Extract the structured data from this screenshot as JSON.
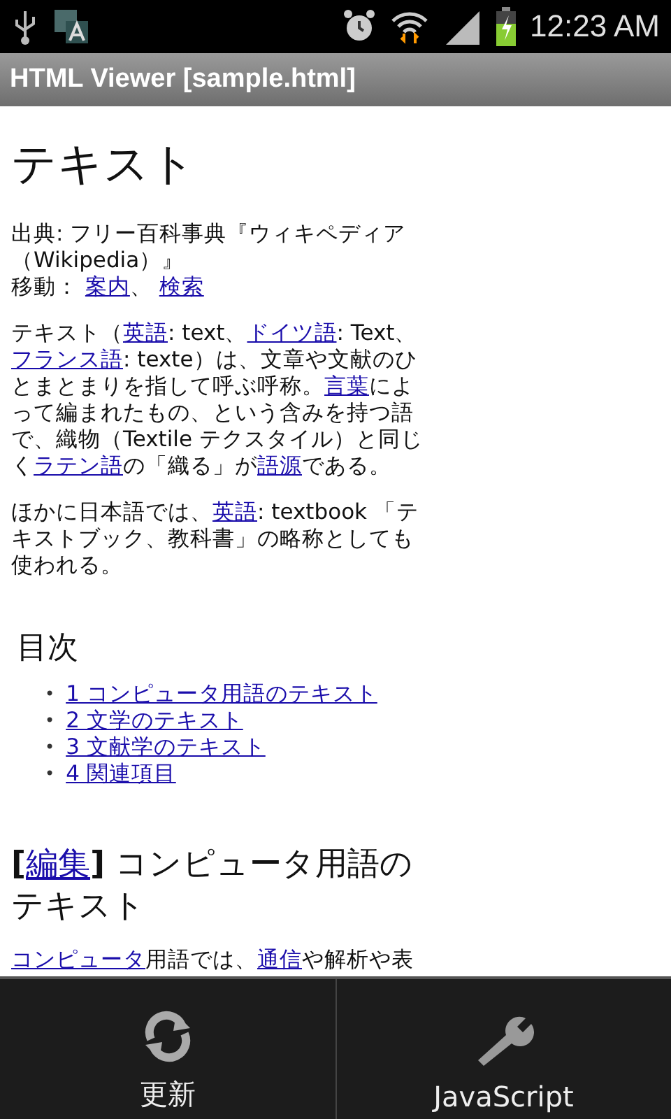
{
  "status_bar": {
    "time": "12:23 AM"
  },
  "title_bar": {
    "title": "HTML Viewer [sample.html]"
  },
  "page": {
    "heading": "テキスト",
    "source": [
      {
        "text": "出典: フリー百科事典『ウィキペディア（Wikipedia）』",
        "kind": "text"
      }
    ],
    "navigation": [
      {
        "text": "移動： ",
        "kind": "text"
      },
      {
        "text": "案内",
        "kind": "link"
      },
      {
        "text": "、 ",
        "kind": "text"
      },
      {
        "text": "検索",
        "kind": "link"
      }
    ],
    "paragraphs": [
      [
        {
          "text": "テキスト（",
          "kind": "text"
        },
        {
          "text": "英語",
          "kind": "link"
        },
        {
          "text": ": text、",
          "kind": "text"
        },
        {
          "text": "ドイツ語",
          "kind": "link"
        },
        {
          "text": ": Text、",
          "kind": "text"
        },
        {
          "text": "フランス語",
          "kind": "link"
        },
        {
          "text": ": texte）は、文章や文献のひとまとまりを指して呼ぶ呼称。",
          "kind": "text"
        },
        {
          "text": "言葉",
          "kind": "link"
        },
        {
          "text": "によって編まれたもの、という含みを持つ語で、織物（Textile テクスタイル）と同じく",
          "kind": "text"
        },
        {
          "text": "ラテン語",
          "kind": "link"
        },
        {
          "text": "の「織る」が",
          "kind": "text"
        },
        {
          "text": "語源",
          "kind": "link"
        },
        {
          "text": "である。",
          "kind": "text"
        }
      ],
      [
        {
          "text": "ほかに日本語では、",
          "kind": "text"
        },
        {
          "text": "英語",
          "kind": "link"
        },
        {
          "text": ": textbook 「テキストブック、教科書」の略称としても使われる。",
          "kind": "text"
        }
      ]
    ],
    "toc_heading": "目次",
    "toc": [
      {
        "bullet": "•",
        "text": "1 コンピュータ用語のテキスト"
      },
      {
        "bullet": "•",
        "text": "2 文学のテキスト"
      },
      {
        "bullet": "•",
        "text": "3 文献学のテキスト"
      },
      {
        "bullet": "•",
        "text": "4 関連項目"
      }
    ],
    "section": {
      "open_bracket": "[",
      "edit_link": "編集",
      "close_bracket": "]",
      "title": " コンピュータ用語のテキスト"
    },
    "section_paragraph": [
      {
        "text": "コンピュータ",
        "kind": "link"
      },
      {
        "text": "用語では、",
        "kind": "text"
      },
      {
        "text": "通信",
        "kind": "link"
      },
      {
        "text": "や解析や表",
        "kind": "text"
      }
    ]
  },
  "menu": [
    {
      "label": "更新",
      "kind": "refresh"
    },
    {
      "label": "JavaScript",
      "kind": "settings"
    }
  ]
}
